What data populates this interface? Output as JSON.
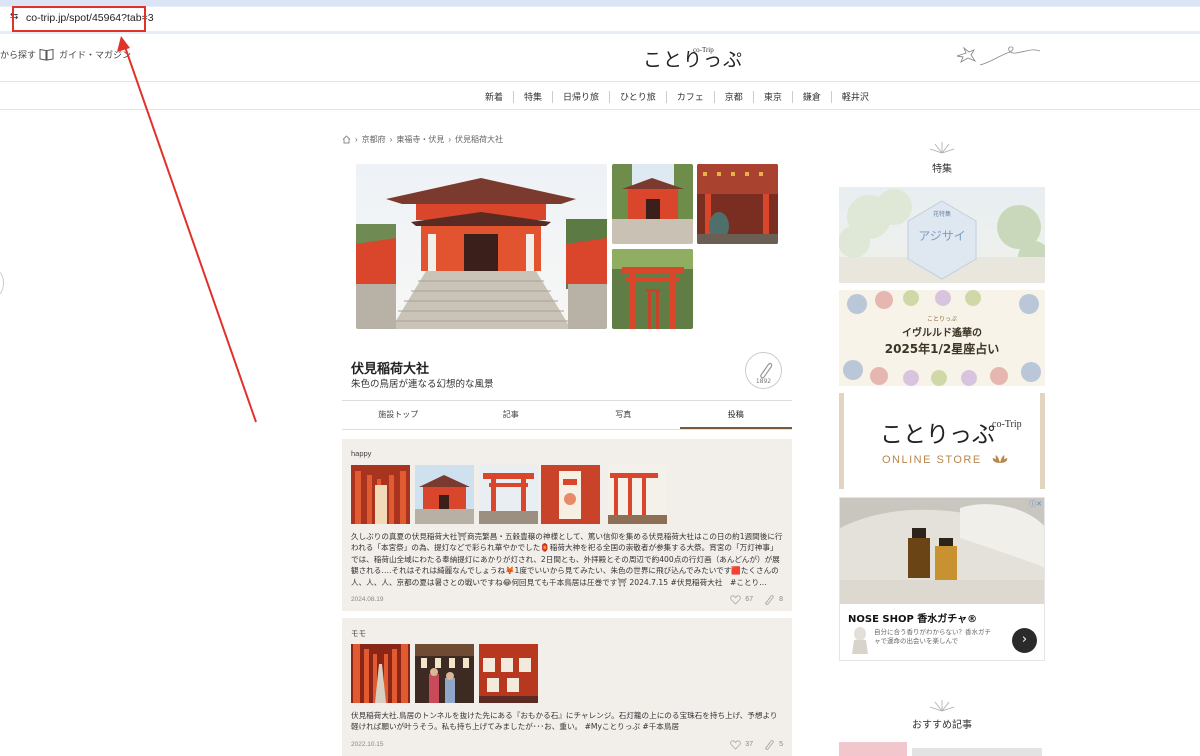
{
  "browser": {
    "url": "co-trip.jp/spot/45964?tab=3"
  },
  "header": {
    "search_label": "から探す",
    "guide_label": "ガイド・マガジン",
    "logo_text": "ことりっぷ",
    "logo_sup": "co-Trip"
  },
  "nav": [
    "新着",
    "特集",
    "日帰り旅",
    "ひとり旅",
    "カフェ",
    "京都",
    "東京",
    "鎌倉",
    "軽井沢"
  ],
  "breadcrumb": [
    "京都府",
    "東福寺・伏見",
    "伏見稲荷大社"
  ],
  "spot": {
    "title": "伏見稲荷大社",
    "subtitle": "朱色の鳥居が連なる幻想的な風景",
    "clip_count": "1892"
  },
  "tabs": [
    {
      "label": "施設トップ",
      "active": false
    },
    {
      "label": "記事",
      "active": false
    },
    {
      "label": "写真",
      "active": false
    },
    {
      "label": "投稿",
      "active": true
    }
  ],
  "posts": [
    {
      "user": "happy",
      "body": "久しぶりの真夏の伏見稲荷大社⛩商売繁昌・五穀豊穣の神様として、篤い信仰を集める伏見稲荷大社はこの日の約1週間後に行われる「本宮祭」の為、提灯などで彩られ華やかでした🏮稲荷大神を祀る全国の崇敬者が参集する大祭。宵宮の「万灯神事」では、稲荷山全域にわたる奉納提灯にあかりが灯され、2日間とも、外拝殿とその周辺で約400点の行灯画（あんどんが）が展観される‥‥それはそれは綺麗なんでしょうね🦊1度でいいから見てみたい、朱色の世界に飛び込んでみたいです🟥たくさんの人、人、人、京都の夏は暑さとの戦いですね😂何回見ても千本鳥居は圧巻です⛩ 2024.7.15 #伏見稲荷大社　#ことり…",
      "date": "2024.08.19",
      "likes": "67",
      "clips": "8"
    },
    {
      "user": "モモ",
      "body": "伏見稲荷大社.鳥居のトンネルを抜けた先にある『おもかる石』にチャレンジ。石灯籠の上にのる宝珠石を持ち上げ、予想より軽ければ願いが叶うそう。私も持ち上げてみましたが･･･お、重い。 #Myことりっぷ #千本鳥居",
      "date": "2022.10.15",
      "likes": "37",
      "clips": "5"
    }
  ],
  "sidebar": {
    "feature_heading": "特集",
    "recommend_heading": "おすすめ記事",
    "banner1_small": "花特集",
    "banner1_title": "アジサイ",
    "banner2_line1": "ことりっぷ",
    "banner2_line2": "イヴルルド遙華の",
    "banner2_line3": "2025年1/2星座占い",
    "store_logo": "ことりっぷ",
    "store_logo_sup": "co-Trip",
    "store_label": "ONLINE STORE",
    "ad_title": "NOSE SHOP 香水ガチャ®",
    "ad_text": "自分に合う香りがわからない？香水ガチャで運命の出会いを楽しんで"
  },
  "colors": {
    "accent_red": "#e0322a",
    "post_bg": "#f2eeea",
    "torii": "#d9462b"
  }
}
